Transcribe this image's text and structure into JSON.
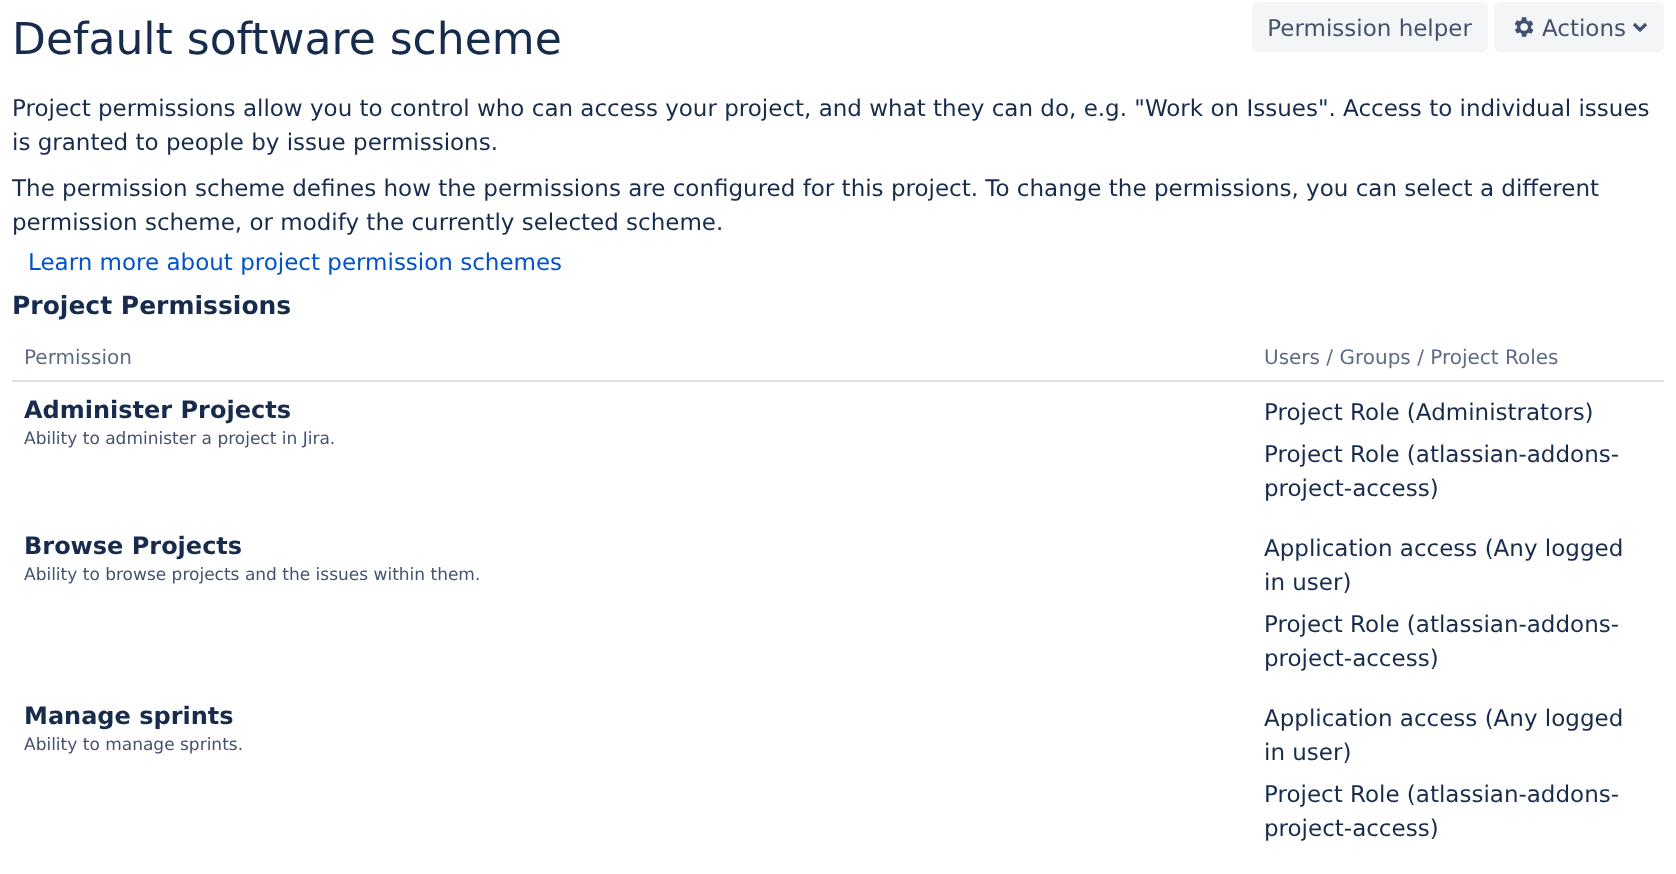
{
  "header": {
    "title": "Default software scheme",
    "buttons": [
      {
        "kind": "plain",
        "label": "Permission helper"
      },
      {
        "kind": "menu",
        "label": "Actions"
      }
    ]
  },
  "intro": [
    "Project permissions allow you to control who can access your project, and what they can do, e.g. \"Work on Issues\". Access to individual issues is granted to people by issue permissions.",
    "The permission scheme defines how the permissions are configured for this project. To change the permissions, you can select a different permission scheme, or modify the currently selected scheme."
  ],
  "learn_more_link": "Learn more about project permission schemes",
  "section_title": "Project Permissions",
  "table": {
    "columns": [
      "Permission",
      "Users / Groups / Project Roles"
    ],
    "rows": [
      {
        "name": "Administer Projects",
        "description": "Ability to administer a project in Jira.",
        "grants": [
          "Project Role (Administrators)",
          "Project Role (atlassian-addons-project-access)"
        ]
      },
      {
        "name": "Browse Projects",
        "description": "Ability to browse projects and the issues within them.",
        "grants": [
          "Application access (Any logged in user)",
          "Project Role (atlassian-addons-project-access)"
        ]
      },
      {
        "name": "Manage sprints",
        "description": "Ability to manage sprints.",
        "grants": [
          "Application access (Any logged in user)",
          "Project Role (atlassian-addons-project-access)"
        ]
      }
    ]
  }
}
